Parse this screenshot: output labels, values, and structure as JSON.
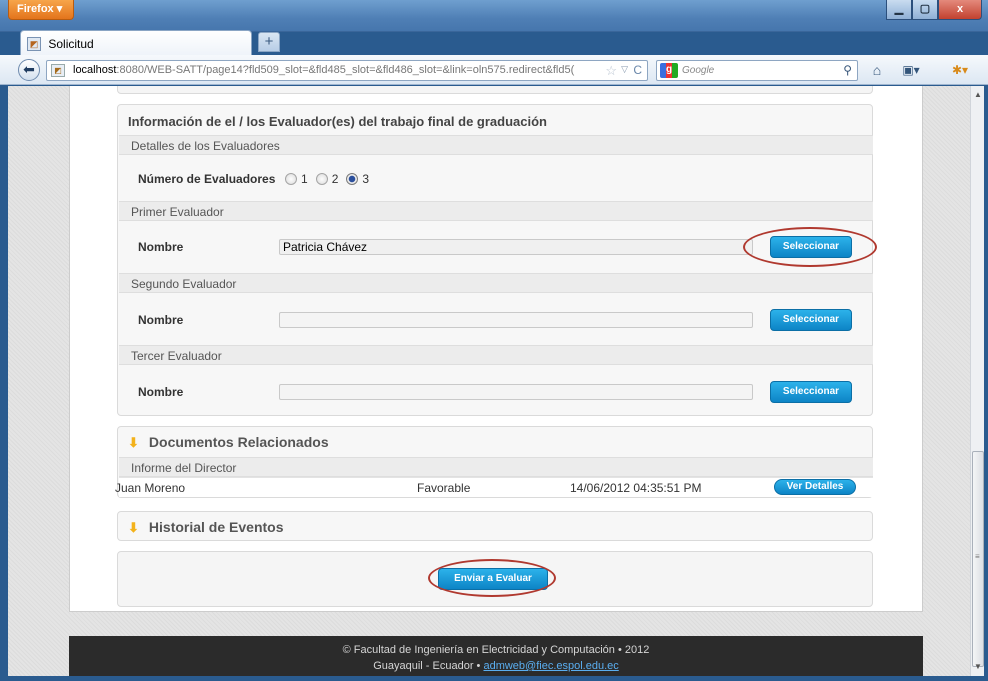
{
  "browser": {
    "menu_label": "Firefox ▾",
    "tab_title": "Solicitud",
    "new_tab_label": "+",
    "url_host": "localhost",
    "url_rest": ":8080/WEB-SATT/page14?fld509_slot=&fld485_slot=&fld486_slot=&link=oln575.redirect&fld5(",
    "search_placeholder": "Google",
    "window_controls": {
      "minimize": "▁",
      "maximize": "▢",
      "close": "x"
    }
  },
  "evaluators_panel": {
    "title": "Información de el / los Evaluador(es) del trabajo final de graduación",
    "details_header": "Detalles de los Evaluadores",
    "count_label": "Número de Evaluadores",
    "count_options": [
      "1",
      "2",
      "3"
    ],
    "count_selected": "3",
    "evaluators": [
      {
        "header": "Primer Evaluador",
        "name_label": "Nombre",
        "name_value": "Patricia Chávez",
        "button_label": "Seleccionar"
      },
      {
        "header": "Segundo Evaluador",
        "name_label": "Nombre",
        "name_value": "",
        "button_label": "Seleccionar"
      },
      {
        "header": "Tercer Evaluador",
        "name_label": "Nombre",
        "name_value": "",
        "button_label": "Seleccionar"
      }
    ]
  },
  "documents_panel": {
    "title": "Documentos Relacionados",
    "sub_header": "Informe del Director",
    "rows": [
      {
        "name": "Juan Moreno",
        "result": "Favorable",
        "date": "14/06/2012 04:35:51 PM",
        "button_label": "Ver Detalles"
      }
    ]
  },
  "history_panel": {
    "title": "Historial de Eventos"
  },
  "submit": {
    "button_label": "Enviar a Evaluar"
  },
  "footer": {
    "line1": "© Facultad de Ingeniería en Electricidad y Computación • 2012",
    "line2_prefix": "Guayaquil - Ecuador • ",
    "email": "admweb@fiec.espol.edu.ec"
  },
  "colors": {
    "accent_button": "#1a9ad6",
    "highlight_ring": "#b0392f",
    "footer_bg": "#2b2b2b"
  }
}
